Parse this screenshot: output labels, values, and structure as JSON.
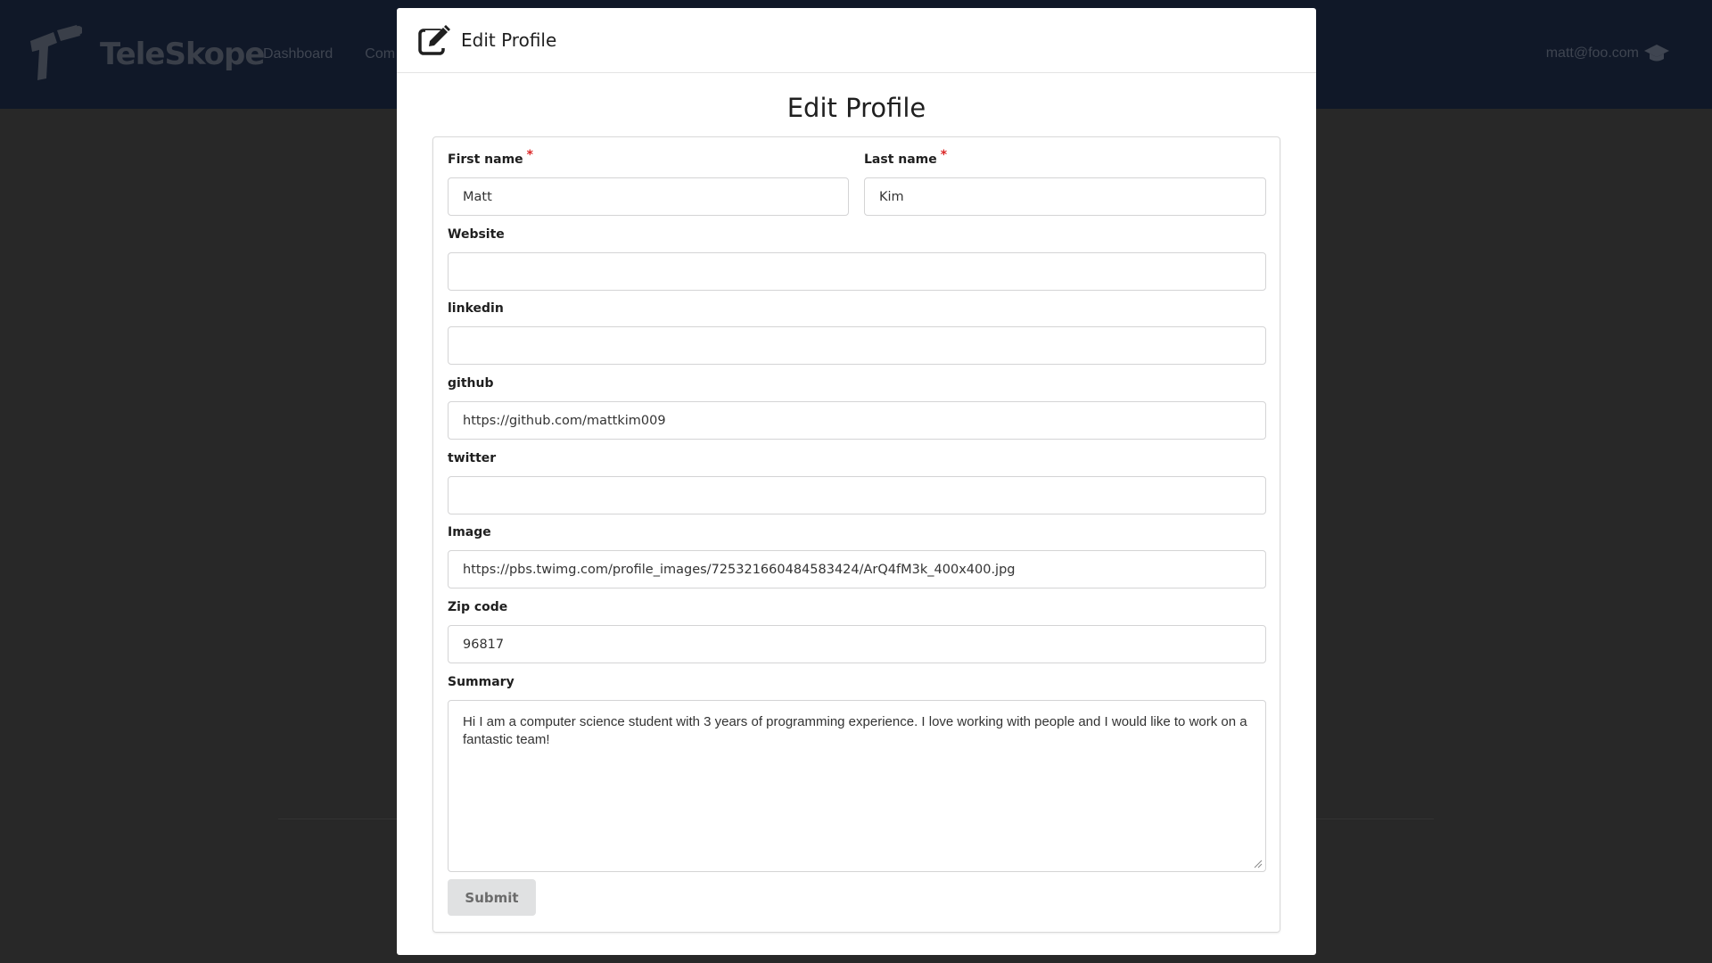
{
  "navbar": {
    "brand": "TeleSkope",
    "links": [
      "Dashboard",
      "Com"
    ],
    "user_email": "matt@foo.com"
  },
  "modal": {
    "header_title": "Edit Profile",
    "form_title": "Edit Profile"
  },
  "form": {
    "first_name": {
      "label": "First name",
      "required": "*",
      "value": "Matt"
    },
    "last_name": {
      "label": "Last name",
      "required": "*",
      "value": "Kim"
    },
    "website": {
      "label": "Website",
      "value": ""
    },
    "linkedin": {
      "label": "linkedin",
      "value": ""
    },
    "github": {
      "label": "github",
      "value": "https://github.com/mattkim009"
    },
    "twitter": {
      "label": "twitter",
      "value": ""
    },
    "image": {
      "label": "Image",
      "value": "https://pbs.twimg.com/profile_images/725321660484583424/ArQ4fM3k_400x400.jpg"
    },
    "zip_code": {
      "label": "Zip code",
      "value": "96817"
    },
    "summary": {
      "label": "Summary",
      "value": "Hi I am a computer science student with 3 years of programming experience. I love working with people and I would like to work on a fantastic team!"
    },
    "submit_label": "Submit"
  },
  "icons": {
    "header": "edit-icon",
    "user": "graduation-cap-icon"
  },
  "colors": {
    "navbar_bg": "#101828",
    "overlay_bg": "#282828",
    "required": "#db2828",
    "submit_bg": "#e0e1e2"
  }
}
